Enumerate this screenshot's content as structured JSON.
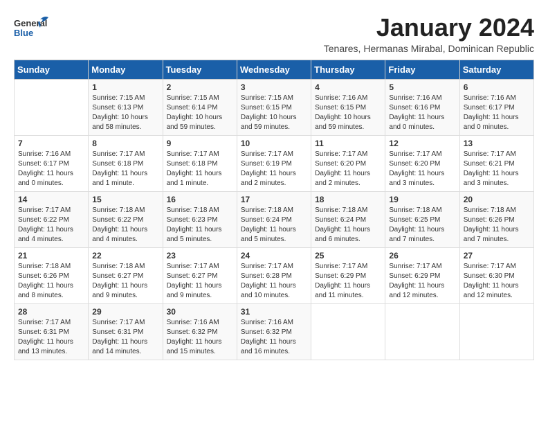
{
  "logo": {
    "line1": "General",
    "line2": "Blue"
  },
  "title": "January 2024",
  "subtitle": "Tenares, Hermanas Mirabal, Dominican Republic",
  "days_of_week": [
    "Sunday",
    "Monday",
    "Tuesday",
    "Wednesday",
    "Thursday",
    "Friday",
    "Saturday"
  ],
  "weeks": [
    [
      {
        "day": "",
        "info": ""
      },
      {
        "day": "1",
        "info": "Sunrise: 7:15 AM\nSunset: 6:13 PM\nDaylight: 10 hours\nand 58 minutes."
      },
      {
        "day": "2",
        "info": "Sunrise: 7:15 AM\nSunset: 6:14 PM\nDaylight: 10 hours\nand 59 minutes."
      },
      {
        "day": "3",
        "info": "Sunrise: 7:15 AM\nSunset: 6:15 PM\nDaylight: 10 hours\nand 59 minutes."
      },
      {
        "day": "4",
        "info": "Sunrise: 7:16 AM\nSunset: 6:15 PM\nDaylight: 10 hours\nand 59 minutes."
      },
      {
        "day": "5",
        "info": "Sunrise: 7:16 AM\nSunset: 6:16 PM\nDaylight: 11 hours\nand 0 minutes."
      },
      {
        "day": "6",
        "info": "Sunrise: 7:16 AM\nSunset: 6:17 PM\nDaylight: 11 hours\nand 0 minutes."
      }
    ],
    [
      {
        "day": "7",
        "info": "Sunrise: 7:16 AM\nSunset: 6:17 PM\nDaylight: 11 hours\nand 0 minutes."
      },
      {
        "day": "8",
        "info": "Sunrise: 7:17 AM\nSunset: 6:18 PM\nDaylight: 11 hours\nand 1 minute."
      },
      {
        "day": "9",
        "info": "Sunrise: 7:17 AM\nSunset: 6:18 PM\nDaylight: 11 hours\nand 1 minute."
      },
      {
        "day": "10",
        "info": "Sunrise: 7:17 AM\nSunset: 6:19 PM\nDaylight: 11 hours\nand 2 minutes."
      },
      {
        "day": "11",
        "info": "Sunrise: 7:17 AM\nSunset: 6:20 PM\nDaylight: 11 hours\nand 2 minutes."
      },
      {
        "day": "12",
        "info": "Sunrise: 7:17 AM\nSunset: 6:20 PM\nDaylight: 11 hours\nand 3 minutes."
      },
      {
        "day": "13",
        "info": "Sunrise: 7:17 AM\nSunset: 6:21 PM\nDaylight: 11 hours\nand 3 minutes."
      }
    ],
    [
      {
        "day": "14",
        "info": "Sunrise: 7:17 AM\nSunset: 6:22 PM\nDaylight: 11 hours\nand 4 minutes."
      },
      {
        "day": "15",
        "info": "Sunrise: 7:18 AM\nSunset: 6:22 PM\nDaylight: 11 hours\nand 4 minutes."
      },
      {
        "day": "16",
        "info": "Sunrise: 7:18 AM\nSunset: 6:23 PM\nDaylight: 11 hours\nand 5 minutes."
      },
      {
        "day": "17",
        "info": "Sunrise: 7:18 AM\nSunset: 6:24 PM\nDaylight: 11 hours\nand 5 minutes."
      },
      {
        "day": "18",
        "info": "Sunrise: 7:18 AM\nSunset: 6:24 PM\nDaylight: 11 hours\nand 6 minutes."
      },
      {
        "day": "19",
        "info": "Sunrise: 7:18 AM\nSunset: 6:25 PM\nDaylight: 11 hours\nand 7 minutes."
      },
      {
        "day": "20",
        "info": "Sunrise: 7:18 AM\nSunset: 6:26 PM\nDaylight: 11 hours\nand 7 minutes."
      }
    ],
    [
      {
        "day": "21",
        "info": "Sunrise: 7:18 AM\nSunset: 6:26 PM\nDaylight: 11 hours\nand 8 minutes."
      },
      {
        "day": "22",
        "info": "Sunrise: 7:18 AM\nSunset: 6:27 PM\nDaylight: 11 hours\nand 9 minutes."
      },
      {
        "day": "23",
        "info": "Sunrise: 7:17 AM\nSunset: 6:27 PM\nDaylight: 11 hours\nand 9 minutes."
      },
      {
        "day": "24",
        "info": "Sunrise: 7:17 AM\nSunset: 6:28 PM\nDaylight: 11 hours\nand 10 minutes."
      },
      {
        "day": "25",
        "info": "Sunrise: 7:17 AM\nSunset: 6:29 PM\nDaylight: 11 hours\nand 11 minutes."
      },
      {
        "day": "26",
        "info": "Sunrise: 7:17 AM\nSunset: 6:29 PM\nDaylight: 11 hours\nand 12 minutes."
      },
      {
        "day": "27",
        "info": "Sunrise: 7:17 AM\nSunset: 6:30 PM\nDaylight: 11 hours\nand 12 minutes."
      }
    ],
    [
      {
        "day": "28",
        "info": "Sunrise: 7:17 AM\nSunset: 6:31 PM\nDaylight: 11 hours\nand 13 minutes."
      },
      {
        "day": "29",
        "info": "Sunrise: 7:17 AM\nSunset: 6:31 PM\nDaylight: 11 hours\nand 14 minutes."
      },
      {
        "day": "30",
        "info": "Sunrise: 7:16 AM\nSunset: 6:32 PM\nDaylight: 11 hours\nand 15 minutes."
      },
      {
        "day": "31",
        "info": "Sunrise: 7:16 AM\nSunset: 6:32 PM\nDaylight: 11 hours\nand 16 minutes."
      },
      {
        "day": "",
        "info": ""
      },
      {
        "day": "",
        "info": ""
      },
      {
        "day": "",
        "info": ""
      }
    ]
  ]
}
